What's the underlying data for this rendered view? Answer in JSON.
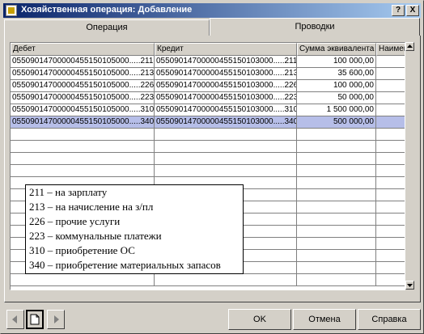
{
  "window": {
    "title": "Хозяйственная операция: Добавление",
    "help_label": "?",
    "close_label": "X"
  },
  "tabs": [
    {
      "label": "Операция"
    },
    {
      "label": "Проводки"
    }
  ],
  "grid": {
    "columns": [
      "Дебет",
      "Кредит",
      "Сумма эквивалента",
      "Наимено"
    ],
    "rows": [
      {
        "debet": "05509014700000455150105000.....211",
        "kredit": "05509014700000455150103000.....211",
        "summa": "100 000,00"
      },
      {
        "debet": "05509014700000455150105000.....213",
        "kredit": "05509014700000455150103000.....213",
        "summa": "35 600,00"
      },
      {
        "debet": "05509014700000455150105000.....226",
        "kredit": "05509014700000455150103000.....226",
        "summa": "100 000,00"
      },
      {
        "debet": "05509014700000455150105000.....223",
        "kredit": "05509014700000455150103000.....223",
        "summa": "50 000,00"
      },
      {
        "debet": "05509014700000455150105000.....310",
        "kredit": "05509014700000455150103000.....310",
        "summa": "1 500 000,00"
      },
      {
        "debet": "05509014700000455150105000.....340",
        "kredit": "05509014700000455150103000.....340",
        "summa": "500 000,00"
      }
    ],
    "selected_row": 5
  },
  "legend": [
    "211 – на зарплату",
    "213 – на начисление на з/пл",
    "226 – прочие услуги",
    "223 – коммунальные платежи",
    "310 – приобретение ОС",
    "340 – приобретение материальных запасов"
  ],
  "buttons": {
    "ok": "OK",
    "cancel": "Отмена",
    "help": "Справка"
  },
  "icons": [
    "arrow-left-icon",
    "new-document-icon",
    "arrow-right-icon",
    "scroll-up-icon",
    "scroll-down-icon"
  ]
}
